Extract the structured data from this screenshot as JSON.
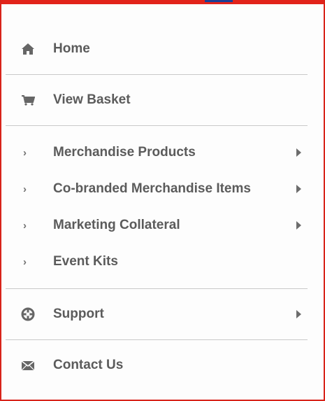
{
  "menu": {
    "home": "Home",
    "view_basket": "View Basket",
    "merchandise_products": "Merchandise Products",
    "co_branded": "Co-branded Merchandise Items",
    "marketing_collateral": "Marketing Collateral",
    "event_kits": "Event Kits",
    "support": "Support",
    "contact_us": "Contact Us"
  },
  "colors": {
    "accent_border": "#d8231a",
    "top_blue": "#1c3f95",
    "text": "#5b5b5b",
    "divider": "#c9c9c9"
  },
  "icons": {
    "home": "home-icon",
    "basket": "cart-icon",
    "support": "lifebuoy-icon",
    "contact": "envelope-icon",
    "submenu": "chevron-right-icon",
    "expand": "triangle-right-icon"
  }
}
